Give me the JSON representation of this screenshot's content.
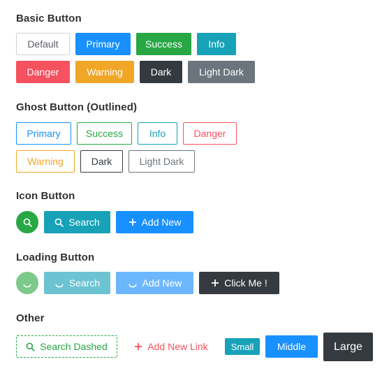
{
  "sections": {
    "basic": "Basic Button",
    "ghost": "Ghost Button (Outlined)",
    "icon": "Icon Button",
    "loading": "Loading Button",
    "other": "Other"
  },
  "basic_buttons": {
    "default": "Default",
    "primary": "Primary",
    "success": "Success",
    "info": "Info",
    "danger": "Danger",
    "warning": "Warning",
    "dark": "Dark",
    "light_dark": "Light Dark"
  },
  "ghost_buttons": {
    "primary": "Primary",
    "success": "Success",
    "info": "Info",
    "danger": "Danger",
    "warning": "Warning",
    "dark": "Dark",
    "light_dark": "Light Dark"
  },
  "icon_buttons": {
    "search_icon": "search-icon",
    "search": "Search",
    "add_new": "Add New"
  },
  "loading_buttons": {
    "search": "Search",
    "add_new": "Add New",
    "click_me": "Click Me !"
  },
  "other_buttons": {
    "search_dashed": "Search Dashed",
    "add_new_link": "Add New Link",
    "small": "Small",
    "middle": "Middle",
    "large": "Large"
  },
  "colors": {
    "primary": "#1890ff",
    "success": "#28a745",
    "info": "#17a2b8",
    "danger": "#f5515f",
    "warning": "#f0a728",
    "dark": "#343a40",
    "light_dark": "#6c757d"
  }
}
